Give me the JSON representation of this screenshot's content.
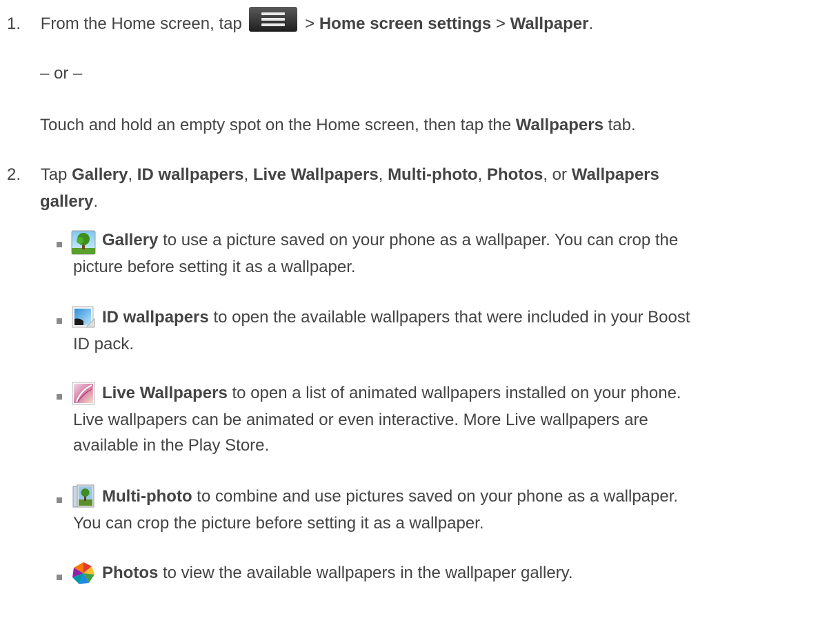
{
  "step1": {
    "number": "1.",
    "pre": "From the Home screen, tap",
    "sep1": ">",
    "bold1": "Home screen settings",
    "sep2": ">",
    "bold2": "Wallpaper",
    "end": ".",
    "menu_icon": "menu-icon"
  },
  "or_text": "– or –",
  "alt": {
    "pre": "Touch and hold an empty spot on the Home screen, then tap the",
    "bold": "Wallpapers",
    "post": "tab."
  },
  "step2": {
    "number": "2.",
    "tap": "Tap",
    "gallery": "Gallery",
    "c1": ",",
    "id_wallpapers": "ID wallpapers",
    "c2": ",",
    "live_wallpapers": "Live Wallpapers",
    "c3": ",",
    "multi_photo": "Multi-photo",
    "c4": ",",
    "photos": "Photos",
    "or": ", or",
    "wallpapers": "Wallpapers",
    "gallery2": "gallery",
    "end": "."
  },
  "bullets": [
    {
      "icon": "gallery-icon",
      "title": "Gallery",
      "line1": "to use a picture saved on your phone as a wallpaper. You can crop the",
      "line2": "picture before setting it as a wallpaper."
    },
    {
      "icon": "id-wallpapers-icon",
      "title": "ID wallpapers",
      "line1": "to open the available wallpapers that were included in your Boost",
      "line2": "ID pack."
    },
    {
      "icon": "live-wallpapers-icon",
      "title": "Live Wallpapers",
      "line1": "to open a list of animated wallpapers installed on your phone.",
      "line2": "Live wallpapers can be animated or even interactive. More Live wallpapers are",
      "line3": "available in the Play Store."
    },
    {
      "icon": "multi-photo-icon",
      "title": "Multi-photo",
      "line1": "to combine and use pictures saved on your phone as a wallpaper.",
      "line2": "You can crop the picture before setting it as a wallpaper."
    },
    {
      "icon": "photos-icon",
      "title": "Photos",
      "line1": "to view the available wallpapers in the wallpaper gallery."
    }
  ]
}
